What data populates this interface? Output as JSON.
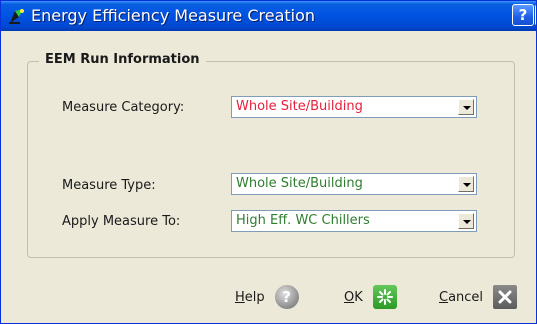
{
  "window": {
    "title": "Energy Efficiency Measure Creation",
    "help_glyph": "?",
    "close_glyph": "X"
  },
  "group": {
    "title": "EEM Run Information"
  },
  "fields": {
    "measure_category": {
      "label": "Measure Category:",
      "value": "Whole Site/Building",
      "color": "#e8203c"
    },
    "measure_type": {
      "label": "Measure Type:",
      "value": "Whole Site/Building",
      "color": "#2e7d2e"
    },
    "apply_measure_to": {
      "label": "Apply Measure To:",
      "value": "High Eff. WC Chillers",
      "color": "#2e7d2e"
    }
  },
  "buttons": {
    "help": {
      "mnemonic": "H",
      "rest": "elp",
      "icon": "help-icon"
    },
    "ok": {
      "mnemonic": "O",
      "rest": "K",
      "icon": "ok-icon"
    },
    "cancel": {
      "mnemonic": "C",
      "rest": "ancel",
      "icon": "cancel-icon"
    }
  }
}
